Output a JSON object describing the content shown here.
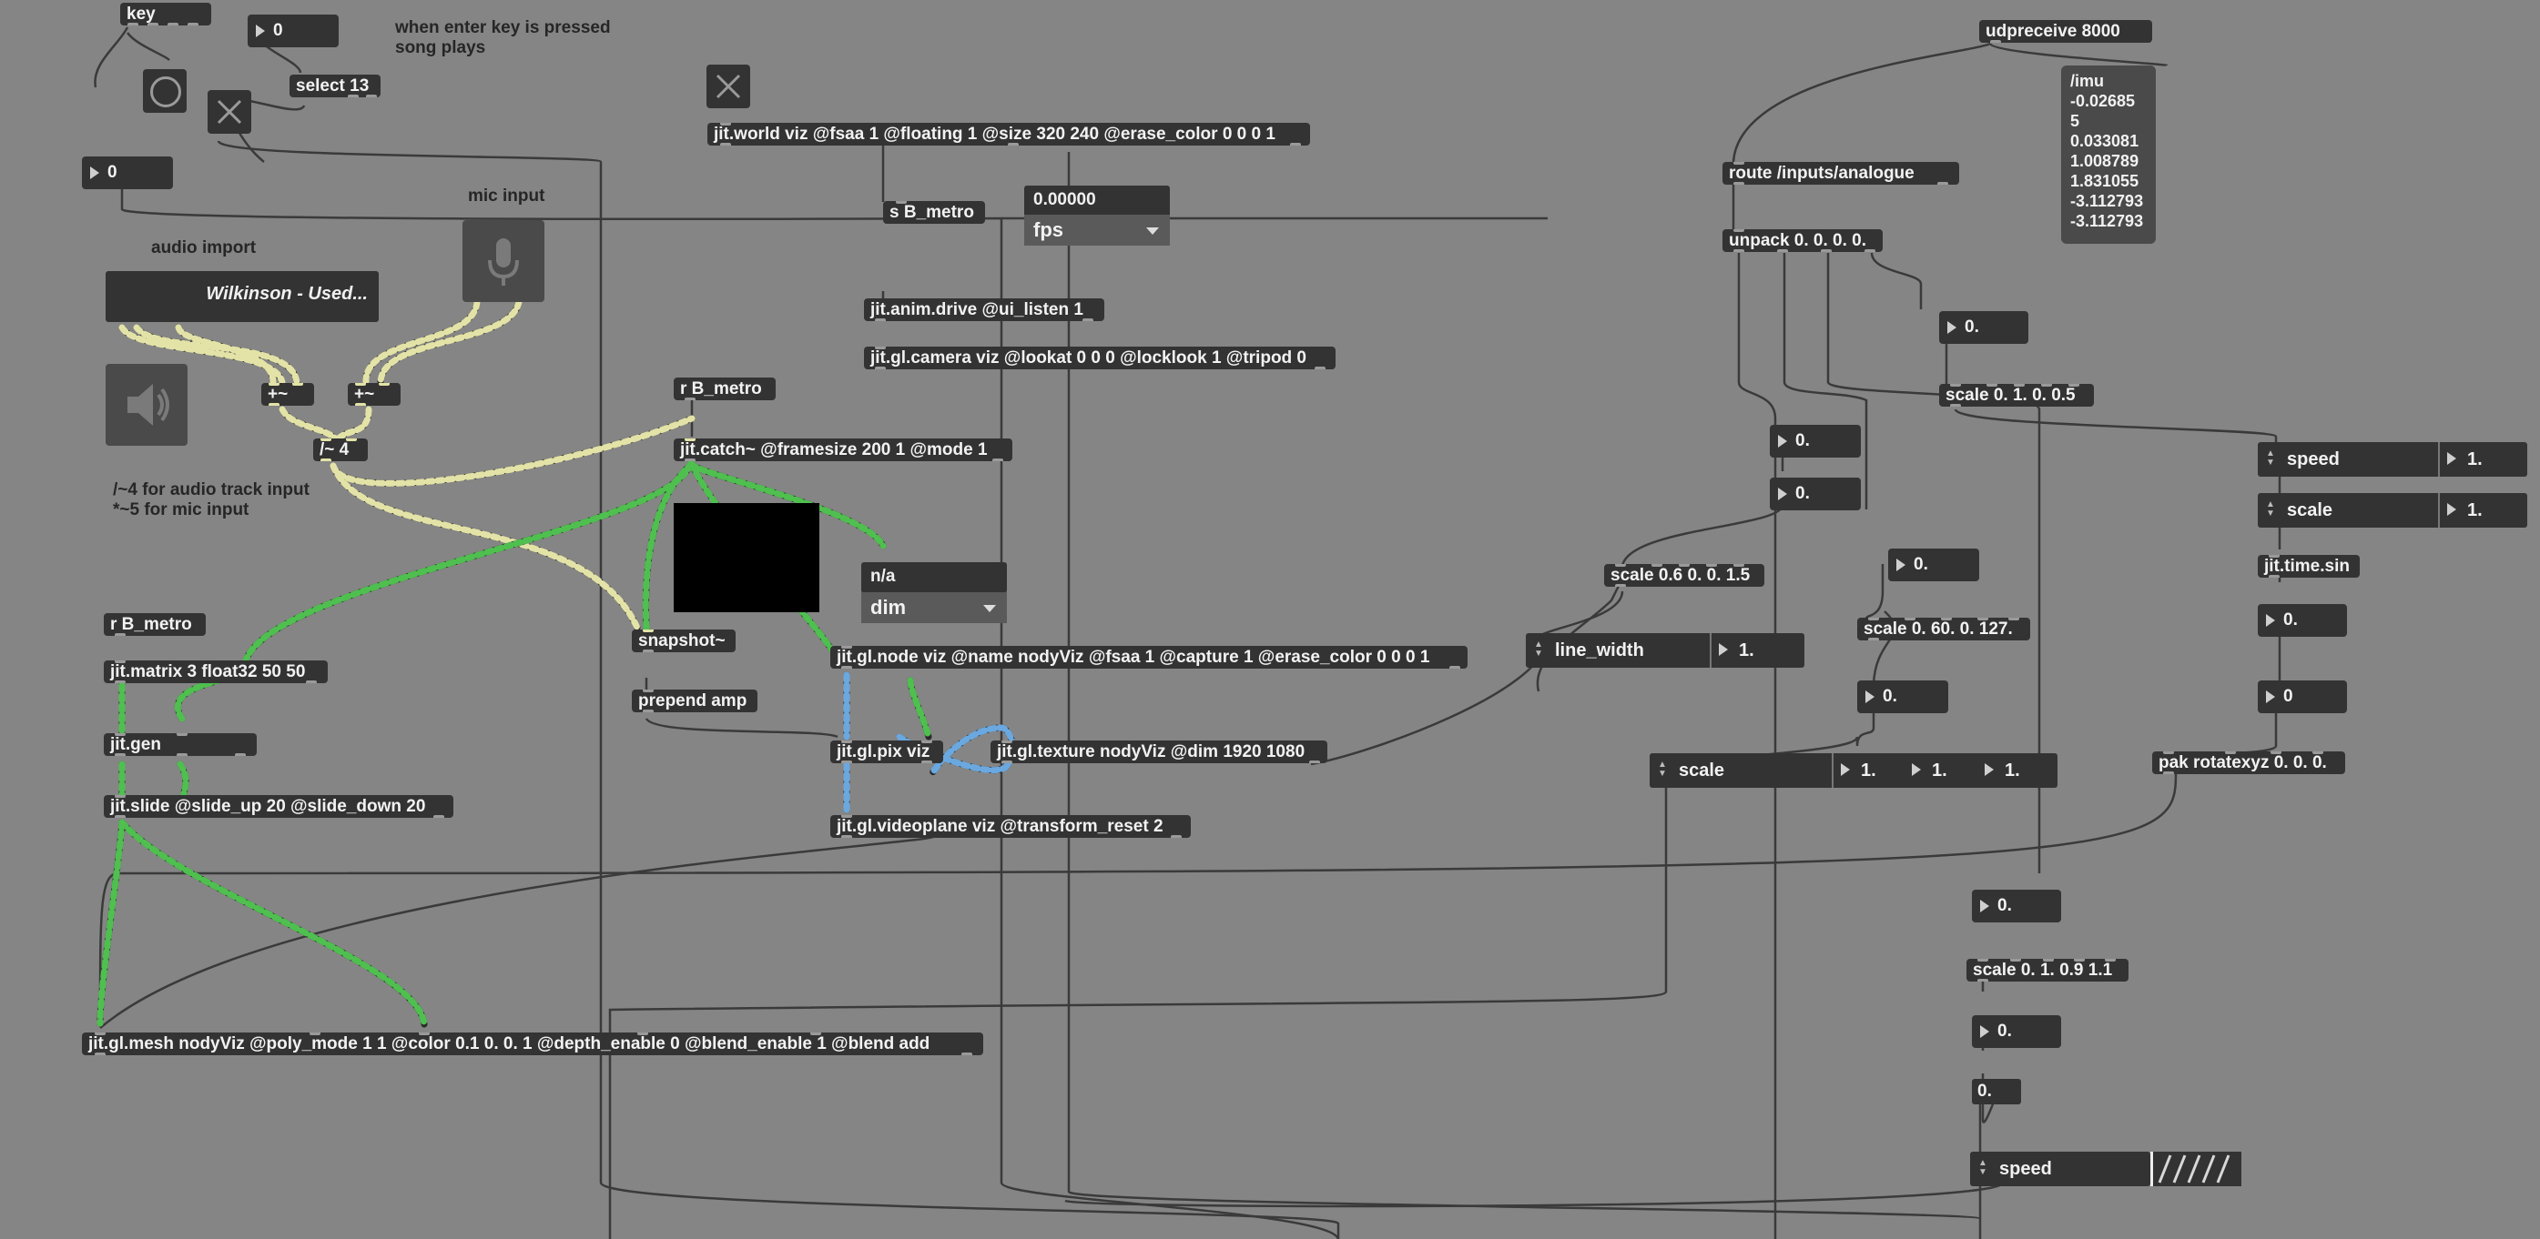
{
  "comments": {
    "enter_hint_1": "when enter key is pressed",
    "enter_hint_2": "song plays",
    "mic_input": "mic input",
    "audio_import": "audio import",
    "divide_hint_1": "/~4 for audio track input",
    "divide_hint_2": "*~5 for mic input"
  },
  "objects": {
    "key": "key",
    "select": "select 13",
    "jit_world": "jit.world viz @fsaa 1 @floating 1 @size 320 240 @erase_color 0 0 0 1",
    "s_metro": "s B_metro",
    "anim_drive": "jit.anim.drive @ui_listen 1",
    "camera": "jit.gl.camera viz @lookat 0 0 0 @locklook 1 @tripod 0",
    "r_metro_1": "r B_metro",
    "catch": "jit.catch~ @framesize 200 1 @mode 1",
    "plus_1": "+~",
    "plus_2": "+~",
    "divide": "/~ 4",
    "r_metro_2": "r B_metro",
    "matrix": "jit.matrix 3 float32 50 50",
    "gen": "jit.gen",
    "slide": "jit.slide @slide_up 20 @slide_down 20",
    "snapshot": "snapshot~",
    "prepend": "prepend amp",
    "node": "jit.gl.node viz @name nodyViz @fsaa 1 @capture 1 @erase_color 0 0 0 1",
    "pix": "jit.gl.pix viz",
    "texture": "jit.gl.texture nodyViz @dim 1920 1080",
    "videoplane": "jit.gl.videoplane viz @transform_reset 2",
    "mesh": "jit.gl.mesh nodyViz @poly_mode 1 1 @color 0.1 0. 0. 1 @depth_enable 0 @blend_enable 1 @blend add",
    "udpreceive": "udpreceive 8000",
    "route": "route /inputs/analogue",
    "unpack": "unpack 0. 0. 0. 0.",
    "scale_a": "scale 0. 1. 0. 0.5",
    "scale_b": "scale 0.6 0. 0. 1.5",
    "scale_c": "scale 0. 60. 0. 127.",
    "jit_time_sin": "jit.time.sin",
    "pak": "pak rotatexyz 0. 0. 0.",
    "scale_d": "scale 0. 1. 0.9 1.1"
  },
  "numbers": {
    "key_out": "0",
    "left_num": "0",
    "unpack_4": "0.",
    "n1": "0.",
    "n2": "0.",
    "n3": "0.",
    "n4": "0.",
    "sin_out": "0.",
    "int_out": "0",
    "r1": "0.",
    "r2": "0.",
    "r3": "0."
  },
  "fps": {
    "value": "0.00000",
    "label": "fps"
  },
  "dim": {
    "value": "n/a",
    "label": "dim"
  },
  "playlist": {
    "title": "Wilkinson - Used..."
  },
  "imu_message": [
    "/imu",
    "-0.02685",
    "5",
    "0.033081",
    "1.008789",
    "1.831055",
    "-3.112793",
    "-3.112793"
  ],
  "dials": {
    "speed": {
      "label": "speed",
      "value": "1."
    },
    "scale": {
      "label": "scale",
      "value": "1."
    },
    "line_width": {
      "label": "line_width",
      "value": "1."
    },
    "scale_xyz": {
      "label": "scale",
      "v1": "1.",
      "v2": "1.",
      "v3": "1."
    },
    "speed_bottom": {
      "label": "speed"
    }
  },
  "colors": {
    "canvas": "#858585",
    "object": "#333333",
    "signal_wire": "#e3e3a8",
    "matrix_wire": "#4fbf4f",
    "texture_wire": "#5aa0d8"
  }
}
